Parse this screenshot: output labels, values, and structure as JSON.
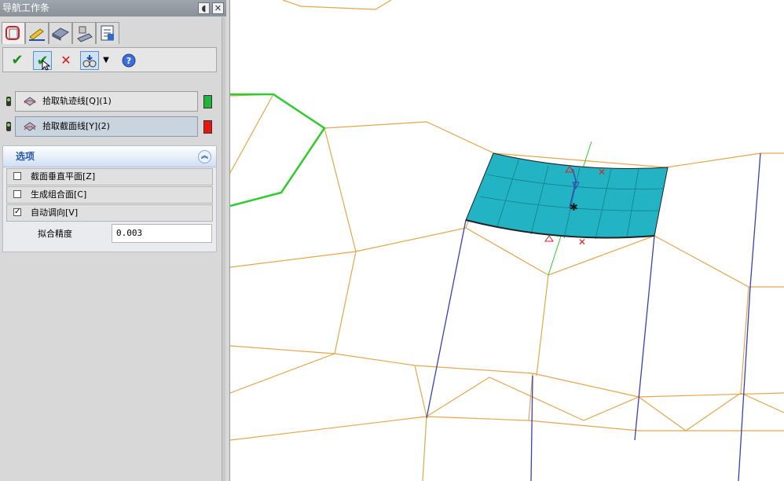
{
  "panel": {
    "title": "导航工作条",
    "pin_icon": "pin-icon",
    "close_icon": "close-icon",
    "tabs": [
      {
        "icon": "feature-tree-icon"
      },
      {
        "icon": "sketch-edit-icon"
      },
      {
        "icon": "surface-icon"
      },
      {
        "icon": "weld-icon"
      },
      {
        "icon": "properties-icon"
      }
    ]
  },
  "toolbar": {
    "ok_icon": "checkmark-icon",
    "apply_icon": "apply-checkmark-icon",
    "cancel_icon": "cancel-x-icon",
    "preview_icon": "preview-glasses-icon",
    "dropdown_icon": "dropdown-arrow-icon",
    "help_icon": "help-icon"
  },
  "picks": [
    {
      "label": "拾取轨迹线[Q]",
      "count": "(1)",
      "swatch": "#1fb53a"
    },
    {
      "label": "拾取截面线[Y]",
      "count": "(2)",
      "swatch": "#e8160c"
    }
  ],
  "options": {
    "title": "选项",
    "rows": [
      {
        "label": "截面垂直平面[Z]",
        "checked": ""
      },
      {
        "label": "生成组合面[C]",
        "checked": ""
      },
      {
        "label": "自动调向[V]",
        "checked": "✓"
      }
    ],
    "fit_label": "拟合精度",
    "fit_value": "0.003"
  },
  "colors": {
    "wire_orange": "#e3a64a",
    "wire_blue": "#3a3fb5",
    "wire_green": "#2ecc2e",
    "surface_cyan": "#22b4c4"
  }
}
